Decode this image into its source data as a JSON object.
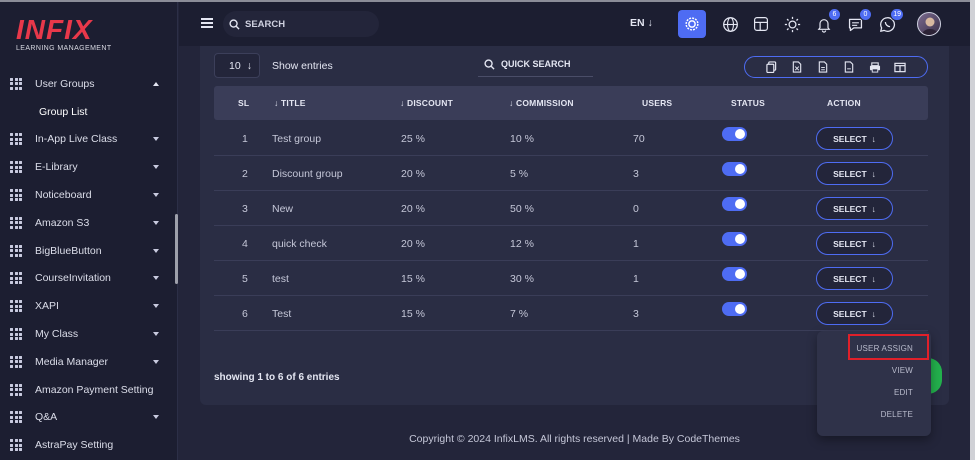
{
  "brand": {
    "logo_word": "INFIX",
    "logo_sub": "LEARNING MANAGEMENT",
    "accent": "#4e6cf3",
    "logo_color": "#e8384a"
  },
  "sidebar": {
    "items": [
      {
        "label": "User Groups",
        "expanded": true
      },
      {
        "label": "In-App Live Class"
      },
      {
        "label": "E-Library"
      },
      {
        "label": "Noticeboard"
      },
      {
        "label": "Amazon S3"
      },
      {
        "label": "BigBlueButton"
      },
      {
        "label": "CourseInvitation"
      },
      {
        "label": "XAPI"
      },
      {
        "label": "My Class"
      },
      {
        "label": "Media Manager"
      },
      {
        "label": "Amazon Payment Setting"
      },
      {
        "label": "Q&A"
      },
      {
        "label": "AstraPay Setting"
      }
    ],
    "subitem": "Group List"
  },
  "header": {
    "search_placeholder": "SEARCH",
    "language": "EN",
    "notifications": {
      "bell": "6",
      "messages": "0",
      "whatsapp": "19"
    }
  },
  "table_controls": {
    "page_size": "10",
    "entries_label": "Show entries",
    "quick_search_placeholder": "QUICK SEARCH"
  },
  "table": {
    "columns": [
      "SL",
      "TITLE",
      "DISCOUNT",
      "COMMISSION",
      "USERS",
      "STATUS",
      "ACTION"
    ],
    "rows": [
      {
        "sl": "1",
        "title": "Test group",
        "discount": "25 %",
        "commission": "10 %",
        "users": "70",
        "status": true,
        "action": "SELECT"
      },
      {
        "sl": "2",
        "title": "Discount group",
        "discount": "20 %",
        "commission": "5 %",
        "users": "3",
        "status": true,
        "action": "SELECT"
      },
      {
        "sl": "3",
        "title": "New",
        "discount": "20 %",
        "commission": "50 %",
        "users": "0",
        "status": true,
        "action": "SELECT"
      },
      {
        "sl": "4",
        "title": "quick check",
        "discount": "20 %",
        "commission": "12 %",
        "users": "1",
        "status": true,
        "action": "SELECT"
      },
      {
        "sl": "5",
        "title": "test",
        "discount": "15 %",
        "commission": "30 %",
        "users": "1",
        "status": true,
        "action": "SELECT"
      },
      {
        "sl": "6",
        "title": "Test",
        "discount": "15 %",
        "commission": "7 %",
        "users": "3",
        "status": true,
        "action": "SELECT"
      }
    ],
    "showing": "showing 1 to 6 of 6 entries"
  },
  "dropdown": {
    "items": [
      "USER ASSIGN",
      "VIEW",
      "EDIT",
      "DELETE"
    ],
    "highlight_color": "#e0202a"
  },
  "footer": {
    "text": "Copyright © 2024 InfixLMS. All rights reserved | Made By CodeThemes"
  }
}
